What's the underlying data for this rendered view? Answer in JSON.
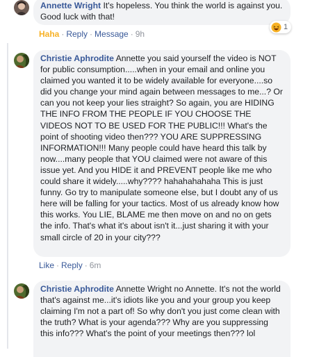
{
  "comments": [
    {
      "author": "Annette Wright",
      "text": "It's hopeless. You think the world is against you. Good luck with that!",
      "actions": {
        "reaction": "Haha",
        "reply": "Reply",
        "message": "Message",
        "time": "9h"
      },
      "reaction_count": "1",
      "reaction_icon": "haha-emoji-icon"
    },
    {
      "author": "Christie Aphrodite",
      "text": "Annette you said yourself the video is NOT for public consumption.....when in your email and online you claimed you wanted it to be widely available for everyone....so did you change your mind again between messages to me...? Or can you not keep your lies straight? So again, you are HIDING THE INFO FROM THE PEOPLE IF YOU CHOOSE THE VIDEOS NOT TO BE USED FOR THE PUBLIC!!! What's the point of shooting video then??? YOU ARE SUPPRESSING INFORMATION!!! Many people could have heard this talk by now....many people that YOU claimed were not aware of this issue yet. And you HIDE it and PREVENT people like me who could share it widely.....why???? hahahahahaha This is just funny. Go try to manipulate someone else, but I doubt any of us here will be falling for your tactics. Most of us already know how this works. You LIE, BLAME me then move on and no on gets the info. That's what it's about isn't it...just sharing it with your small circle of 20 in your city???",
      "actions": {
        "like": "Like",
        "reply": "Reply",
        "time": "6m"
      }
    },
    {
      "author": "Christie Aphrodite",
      "text": "Annette Wright no Annette. It's not the world that's against me...it's idiots like you and your group you keep claiming I'm not a part of! So why don't you just come clean with the truth? What is your agenda??? Why are you suppressing this info??? What's the point of your meetings then??? lol"
    }
  ],
  "colors": {
    "author": "#385898",
    "bubble": "#f2f3f5",
    "haha": "#f7b125",
    "muted": "#90949c"
  }
}
